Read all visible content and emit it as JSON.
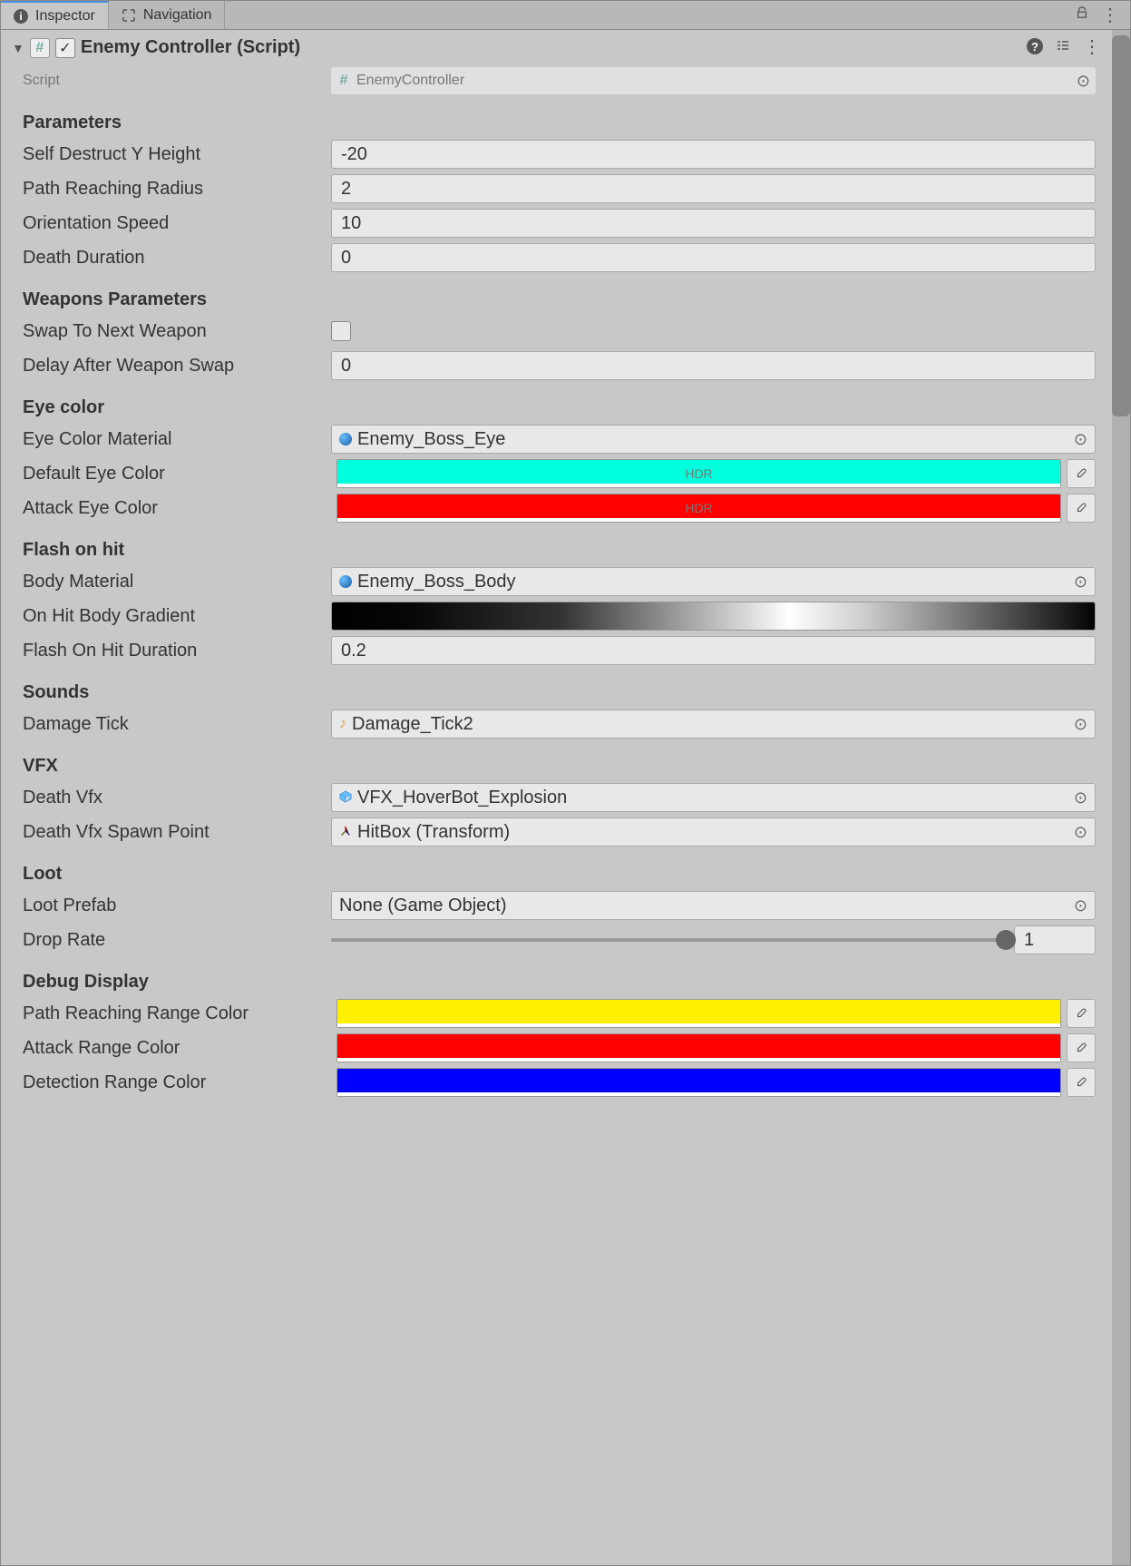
{
  "tabs": {
    "inspector": "Inspector",
    "navigation": "Navigation"
  },
  "component": {
    "title": "Enemy Controller (Script)"
  },
  "script": {
    "label": "Script",
    "value": "EnemyController"
  },
  "sections": {
    "parameters": "Parameters",
    "weapons": "Weapons Parameters",
    "eyeColor": "Eye color",
    "flash": "Flash on hit",
    "sounds": "Sounds",
    "vfx": "VFX",
    "loot": "Loot",
    "debug": "Debug Display"
  },
  "parameters": {
    "selfDestructYHeight_label": "Self Destruct Y Height",
    "selfDestructYHeight": "-20",
    "pathReachingRadius_label": "Path Reaching Radius",
    "pathReachingRadius": "2",
    "orientationSpeed_label": "Orientation Speed",
    "orientationSpeed": "10",
    "deathDuration_label": "Death Duration",
    "deathDuration": "0"
  },
  "weapons": {
    "swapToNextWeapon_label": "Swap To Next Weapon",
    "swapToNextWeapon": false,
    "delayAfterSwap_label": "Delay After Weapon Swap",
    "delayAfterSwap": "0"
  },
  "eye": {
    "material_label": "Eye Color Material",
    "material": "Enemy_Boss_Eye",
    "defaultColor_label": "Default Eye Color",
    "defaultColor": "#00ffdd",
    "attackColor_label": "Attack Eye Color",
    "attackColor": "#ff0000"
  },
  "flash": {
    "bodyMaterial_label": "Body Material",
    "bodyMaterial": "Enemy_Boss_Body",
    "gradient_label": "On Hit Body Gradient",
    "duration_label": "Flash On Hit Duration",
    "duration": "0.2"
  },
  "sounds": {
    "damageTick_label": "Damage Tick",
    "damageTick": "Damage_Tick2"
  },
  "vfx": {
    "deathVfx_label": "Death Vfx",
    "deathVfx": "VFX_HoverBot_Explosion",
    "deathVfxSpawn_label": "Death Vfx Spawn Point",
    "deathVfxSpawn": "HitBox (Transform)"
  },
  "loot": {
    "prefab_label": "Loot Prefab",
    "prefab": "None (Game Object)",
    "dropRate_label": "Drop Rate",
    "dropRate": "1"
  },
  "debug": {
    "pathColor_label": "Path Reaching Range Color",
    "pathColor": "#fff000",
    "attackColor_label": "Attack Range Color",
    "attackColor": "#ff0000",
    "detectColor_label": "Detection Range Color",
    "detectColor": "#0000ff"
  }
}
